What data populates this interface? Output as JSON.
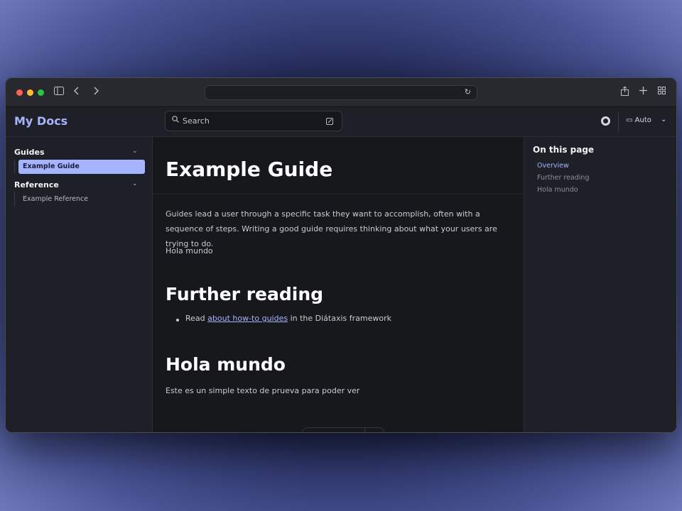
{
  "browser": {
    "traffic_colors": [
      "#ff5f57",
      "#febc2e",
      "#28c840"
    ],
    "sidebar_toggle_icon": "sidebar-icon",
    "back_icon": "chevron-left-icon",
    "forward_icon": "chevron-right-icon",
    "reload_icon": "reload-icon",
    "share_icon": "share-icon",
    "new_tab_icon": "plus-icon",
    "tabs_icon": "grid-icon"
  },
  "header": {
    "brand": "My Docs",
    "search_placeholder": "Search",
    "theme_label": "Auto",
    "accent": "#a5b4fc"
  },
  "sidebar": {
    "sections": [
      {
        "title": "Guides",
        "items": [
          {
            "label": "Example Guide",
            "active": true
          }
        ]
      },
      {
        "title": "Reference",
        "items": [
          {
            "label": "Example Reference",
            "active": false
          }
        ]
      }
    ]
  },
  "content": {
    "title": "Example Guide",
    "intro": "Guides lead a user through a specific task they want to accomplish, often with a sequence of steps. Writing a good guide requires thinking about what your users are trying to do.",
    "hola": "Hola mundo",
    "further_heading": "Further reading",
    "bullet_prefix": "Read ",
    "bullet_link": "about how-to guides",
    "bullet_suffix": " in the Diátaxis framework",
    "hola_heading": "Hola mundo",
    "hola_text": "Este es un simple texto de prueva para poder ver"
  },
  "toc": {
    "title": "On this page",
    "items": [
      {
        "label": "Overview",
        "active": true
      },
      {
        "label": "Further reading",
        "active": false
      },
      {
        "label": "Hola mundo",
        "active": false
      }
    ]
  }
}
